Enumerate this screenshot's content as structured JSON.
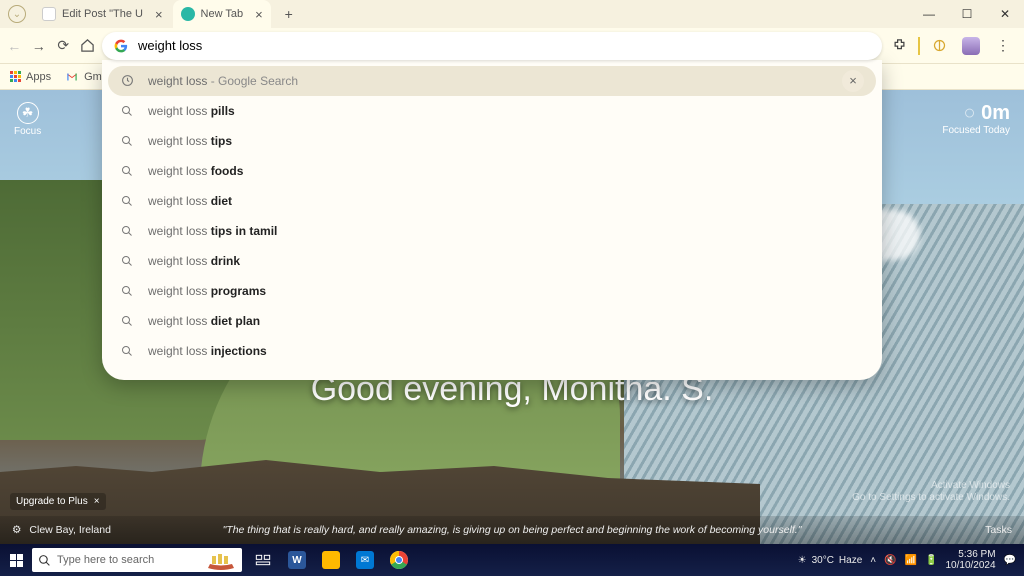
{
  "tabs": {
    "inactive_title": "Edit Post \"The U",
    "active_title": "New Tab"
  },
  "omnibox": {
    "query": "weight loss"
  },
  "bookmarks": {
    "apps": "Apps",
    "gmail": "Gmail"
  },
  "suggestions": [
    {
      "prefix": "weight loss",
      "bold": "",
      "hint": " - Google Search",
      "history": true,
      "removable": true
    },
    {
      "prefix": "weight loss ",
      "bold": "pills",
      "hint": "",
      "history": false
    },
    {
      "prefix": "weight loss ",
      "bold": "tips",
      "hint": "",
      "history": false
    },
    {
      "prefix": "weight loss ",
      "bold": "foods",
      "hint": "",
      "history": false
    },
    {
      "prefix": "weight loss ",
      "bold": "diet",
      "hint": "",
      "history": false
    },
    {
      "prefix": "weight loss ",
      "bold": "tips in tamil",
      "hint": "",
      "history": false
    },
    {
      "prefix": "weight loss ",
      "bold": "drink",
      "hint": "",
      "history": false
    },
    {
      "prefix": "weight loss ",
      "bold": "programs",
      "hint": "",
      "history": false
    },
    {
      "prefix": "weight loss ",
      "bold": "diet plan",
      "hint": "",
      "history": false
    },
    {
      "prefix": "weight loss ",
      "bold": "injections",
      "hint": "",
      "history": false
    }
  ],
  "newtab_page": {
    "focus_label": "Focus",
    "focused_value": "0m",
    "focused_label": "Focused Today",
    "greeting": "Good evening, Monitha. S.",
    "upgrade": "Upgrade to Plus",
    "location": "Clew Bay, Ireland",
    "quote": "\"The thing that is really hard, and really amazing, is giving up on being perfect and beginning the work of becoming yourself.\"",
    "tasks": "Tasks",
    "watermark_1": "Activate Windows",
    "watermark_2": "Go to Settings to activate Windows."
  },
  "taskbar": {
    "search_placeholder": "Type here to search",
    "weather_temp": "30°C",
    "weather_cond": "Haze",
    "time": "5:36 PM",
    "date": "10/10/2024"
  }
}
